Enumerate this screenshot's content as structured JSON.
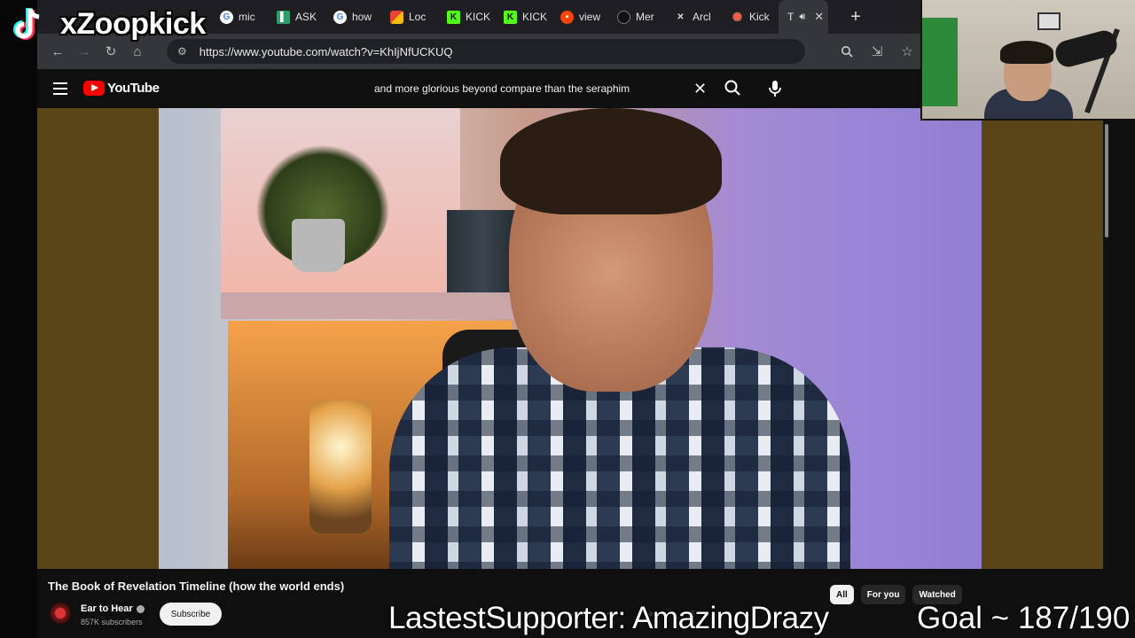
{
  "overlay": {
    "streamer_name": "xZoopkick",
    "ticker": "LastestSupporter: AmazingDrazy",
    "goal": "Goal ~ 187/190"
  },
  "browser": {
    "tabs": [
      {
        "label": "mic",
        "icon": "google-icon",
        "color": "#4285f4"
      },
      {
        "label": "ASK",
        "icon": "doc-icon",
        "color": "#2e9e6b"
      },
      {
        "label": "how",
        "icon": "google-icon",
        "color": "#4285f4"
      },
      {
        "label": "Loc",
        "icon": "maps-icon",
        "color": "#ea4335"
      },
      {
        "label": "KICK",
        "icon": "kick-icon",
        "color": "#53fc18"
      },
      {
        "label": "KICK",
        "icon": "kick-icon",
        "color": "#53fc18"
      },
      {
        "label": "view",
        "icon": "reddit-icon",
        "color": "#ff4500"
      },
      {
        "label": "Mer",
        "icon": "github-icon",
        "color": "#222222"
      },
      {
        "label": "Arcl",
        "icon": "x-icon",
        "color": "#333333"
      },
      {
        "label": "Kick",
        "icon": "asterisk-icon",
        "color": "#e8634a"
      },
      {
        "label": "T",
        "icon": "speaker-icon",
        "color": "#cccccc",
        "active": true
      }
    ],
    "url": "https://www.youtube.com/watch?v=KhIjNfUCKUQ"
  },
  "youtube": {
    "logo_text": "YouTube",
    "search_query": "and more glorious beyond compare than the seraphim",
    "video": {
      "title": "The Book of Revelation Timeline (how the world ends)",
      "channel": "Ear to Hear",
      "subscribers": "857K subscribers",
      "subscribe_label": "Subscribe"
    },
    "chips": [
      {
        "label": "All",
        "selected": true
      },
      {
        "label": "For you",
        "selected": false
      },
      {
        "label": "Watched",
        "selected": false
      }
    ]
  }
}
